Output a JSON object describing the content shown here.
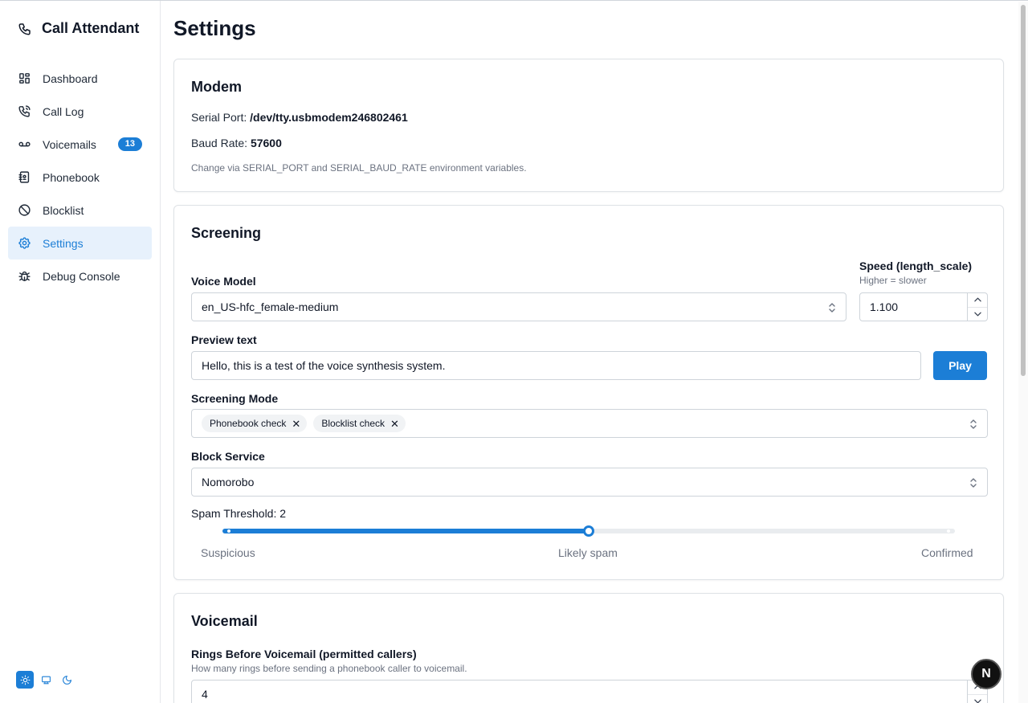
{
  "app": {
    "title": "Call Attendant"
  },
  "sidebar": {
    "items": [
      {
        "label": "Dashboard"
      },
      {
        "label": "Call Log"
      },
      {
        "label": "Voicemails",
        "badge": "13"
      },
      {
        "label": "Phonebook"
      },
      {
        "label": "Blocklist"
      },
      {
        "label": "Settings",
        "active": true
      },
      {
        "label": "Debug Console"
      }
    ],
    "accent": "#1c7ed6"
  },
  "page": {
    "title": "Settings"
  },
  "modem": {
    "title": "Modem",
    "serial_label": "Serial Port:",
    "serial_value": "/dev/tty.usbmodem246802461",
    "baud_label": "Baud Rate:",
    "baud_value": "57600",
    "hint": "Change via SERIAL_PORT and SERIAL_BAUD_RATE environment variables."
  },
  "screening": {
    "title": "Screening",
    "voice_model_label": "Voice Model",
    "voice_model_value": "en_US-hfc_female-medium",
    "speed_label": "Speed (length_scale)",
    "speed_hint": "Higher = slower",
    "speed_value": "1.100",
    "preview_label": "Preview text",
    "preview_value": "Hello, this is a test of the voice synthesis system.",
    "play_label": "Play",
    "mode_label": "Screening Mode",
    "mode_tags": [
      "Phonebook check",
      "Blocklist check"
    ],
    "block_service_label": "Block Service",
    "block_service_value": "Nomorobo",
    "spam_threshold_label": "Spam Threshold: 2",
    "spam_threshold_value": 2,
    "spam_marks": [
      "Suspicious",
      "Likely spam",
      "Confirmed"
    ]
  },
  "voicemail": {
    "title": "Voicemail",
    "rings_label": "Rings Before Voicemail (permitted callers)",
    "rings_hint": "How many rings before sending a phonebook caller to voicemail.",
    "rings_value": "4"
  },
  "fab": {
    "label": "N"
  }
}
